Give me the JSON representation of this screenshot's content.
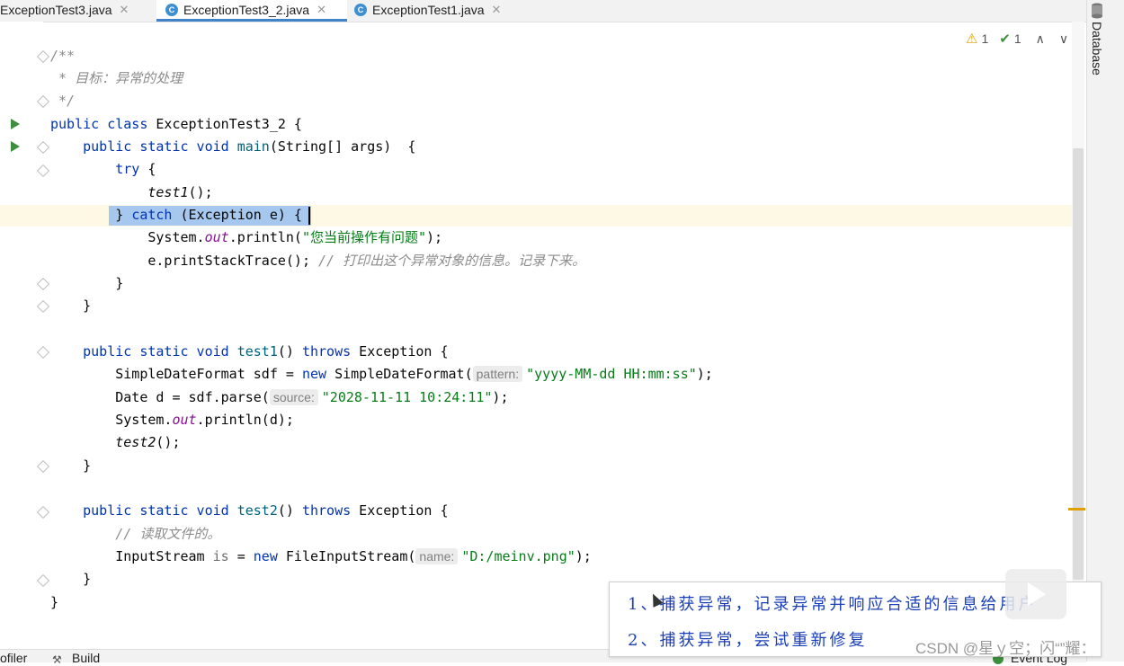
{
  "tabs": [
    {
      "label": "ExceptionTest3.java",
      "active": false
    },
    {
      "label": "ExceptionTest3_2.java",
      "active": true
    },
    {
      "label": "ExceptionTest1.java",
      "active": false
    }
  ],
  "tab_close_glyph": "✕",
  "file_icon_letter": "C",
  "right_panel": {
    "label": "Database"
  },
  "inspections": {
    "warnings": "1",
    "weak_warnings": "1"
  },
  "code": {
    "l1": "/**",
    "l2": " * 目标：异常的处理",
    "l3": " */",
    "l4a": "public class",
    "l4b": " ExceptionTest3_2 {",
    "l5a": "    public static void",
    "l5b": " main",
    "l5c": "(String[] args)  {",
    "l6a": "        try",
    "l6b": " {",
    "l7": "            test1",
    "l7b": "();",
    "l8a": "        } ",
    "l8b": "catch",
    "l8c": " (Exception e) {",
    "l9a": "            System.",
    "l9b": "out",
    "l9c": ".println(",
    "l9d": "\"您当前操作有问题\"",
    "l9e": ");",
    "l10a": "            e.printStackTrace(); ",
    "l10b": "// 打印出这个异常对象的信息。记录下来。",
    "l11": "        }",
    "l12": "    }",
    "l14a": "    public static void",
    "l14b": " test1",
    "l14c": "() ",
    "l14d": "throws",
    "l14e": " Exception {",
    "l15a": "        SimpleDateFormat sdf = ",
    "l15b": "new",
    "l15c": " SimpleDateFormat(",
    "l15hint": "pattern:",
    "l15d": "\"yyyy-MM-dd HH:mm:ss\"",
    "l15e": ");",
    "l16a": "        Date d = sdf.parse(",
    "l16hint": "source:",
    "l16b": "\"2028-11-11 10:24:11\"",
    "l16c": ");",
    "l17a": "        System.",
    "l17b": "out",
    "l17c": ".println(d);",
    "l18a": "        test2",
    "l18b": "();",
    "l19": "    }",
    "l21a": "    public static void",
    "l21b": " test2",
    "l21c": "() ",
    "l21d": "throws",
    "l21e": " Exception {",
    "l22": "        // 读取文件的。",
    "l23a": "        InputStream ",
    "l23b": "is",
    "l23c": " = ",
    "l23d": "new",
    "l23e": " FileInputStream(",
    "l23hint": "name:",
    "l23f": "\"D:/meinv.png\"",
    "l23g": ");",
    "l24": "    }",
    "l25": "}"
  },
  "bottom_bar": {
    "profiler": "ofiler",
    "build": "Build",
    "event_log": "Event Log"
  },
  "annotation": {
    "line1": "1、捕获异常，记录异常并响应合适的信息给用户",
    "line2": "2、捕获异常，尝试重新修复"
  },
  "watermark": "CSDN @星ｙ空；闪“”耀：",
  "colors": {
    "keyword": "#0033b3",
    "string": "#067d17",
    "comment": "#8c8c8c",
    "selection": "#a6c8ee",
    "annotation_ink": "#1a3fb8"
  }
}
